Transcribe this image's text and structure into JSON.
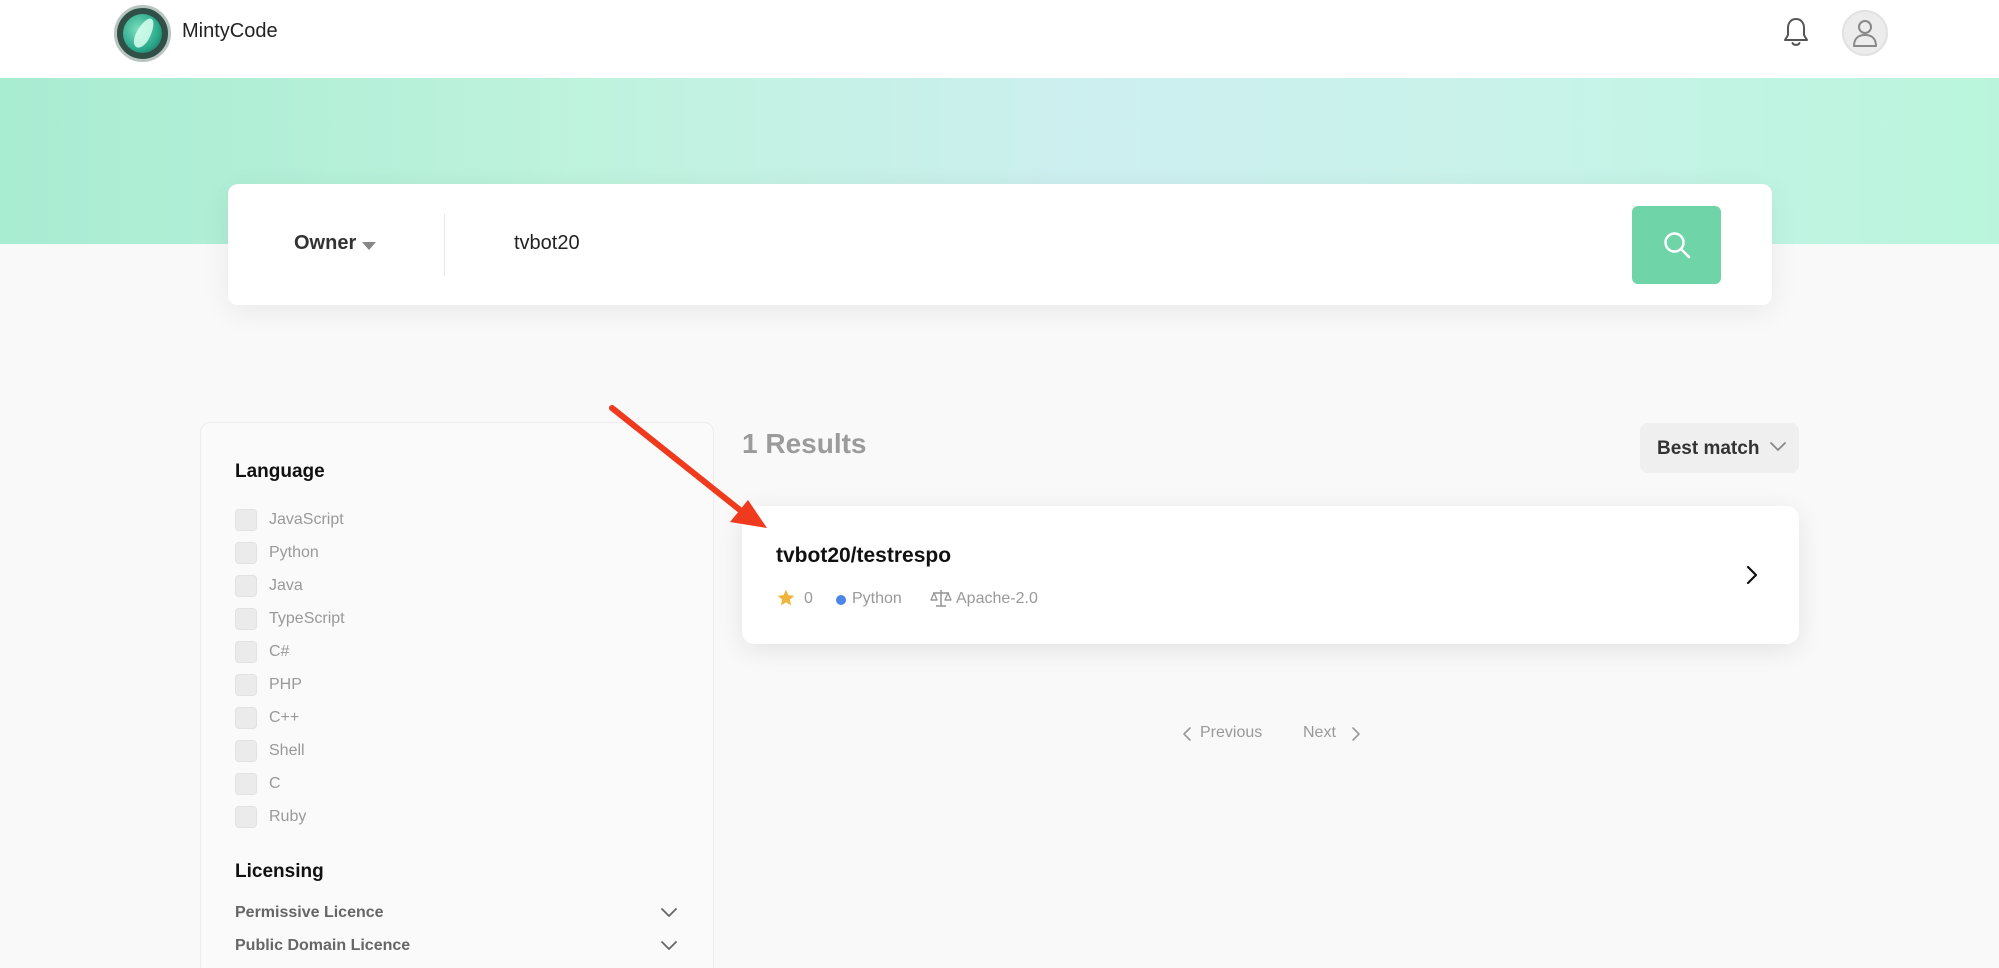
{
  "header": {
    "brand": "MintyCode",
    "bell_icon": "bell-icon",
    "avatar_icon": "user-icon"
  },
  "search": {
    "scope_label": "Owner",
    "query": "tvbot20",
    "button_icon": "search-icon",
    "accent_color": "#6fd4a8"
  },
  "filters": {
    "language_title": "Language",
    "languages": [
      "JavaScript",
      "Python",
      "Java",
      "TypeScript",
      "C#",
      "PHP",
      "C++",
      "Shell",
      "C",
      "Ruby"
    ],
    "licensing_title": "Licensing",
    "licences": [
      "Permissive Licence",
      "Public Domain Licence"
    ]
  },
  "results": {
    "count_label": "1 Results",
    "sort_label": "Best match",
    "items": [
      {
        "name": "tvbot20/testrespo",
        "stars": "0",
        "language": "Python",
        "language_color": "#4a86e8",
        "license": "Apache-2.0"
      }
    ]
  },
  "pagination": {
    "previous": "Previous",
    "next": "Next"
  },
  "annotation": {
    "arrow_color": "#f03a1e"
  }
}
